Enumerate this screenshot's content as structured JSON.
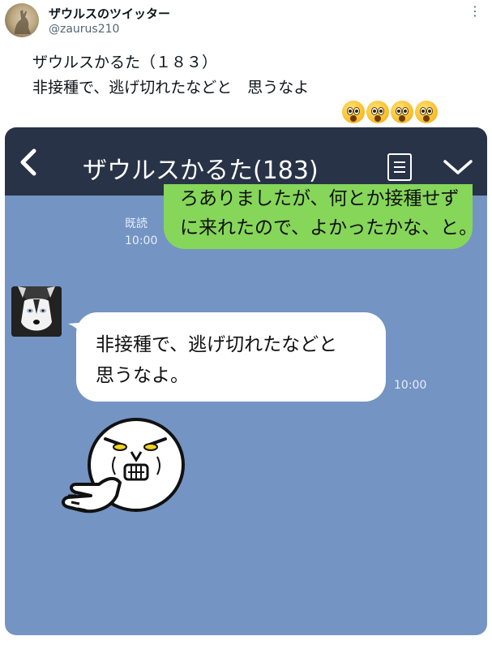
{
  "tweet": {
    "display_name": "ザウルスのツイッター",
    "handle": "@zaurus210",
    "more_label": "⋮",
    "line1": "ザウルスかるた（１８３）",
    "line2": "非接種で、逃げ切れたなどと　思うなよ",
    "emoji_name": "astonished-face-emoji",
    "emoji_count": 4
  },
  "chat": {
    "title": "ザウルスかるた(183)",
    "header_color": "#283347",
    "background_color": "#7494c3",
    "sent_bubble_color": "#86d65a",
    "sent": {
      "line1": "ろありましたが、何とか接種せず",
      "line2": "に来れたので、よかったかな、と。",
      "read_label": "既読",
      "time": "10:00"
    },
    "received": {
      "line1": "非接種で、逃げ切れたなどと",
      "line2": "思うなよ。",
      "time": "10:00"
    },
    "icons": [
      "back-arrow-icon",
      "menu-list-icon",
      "chevron-down-icon"
    ]
  }
}
